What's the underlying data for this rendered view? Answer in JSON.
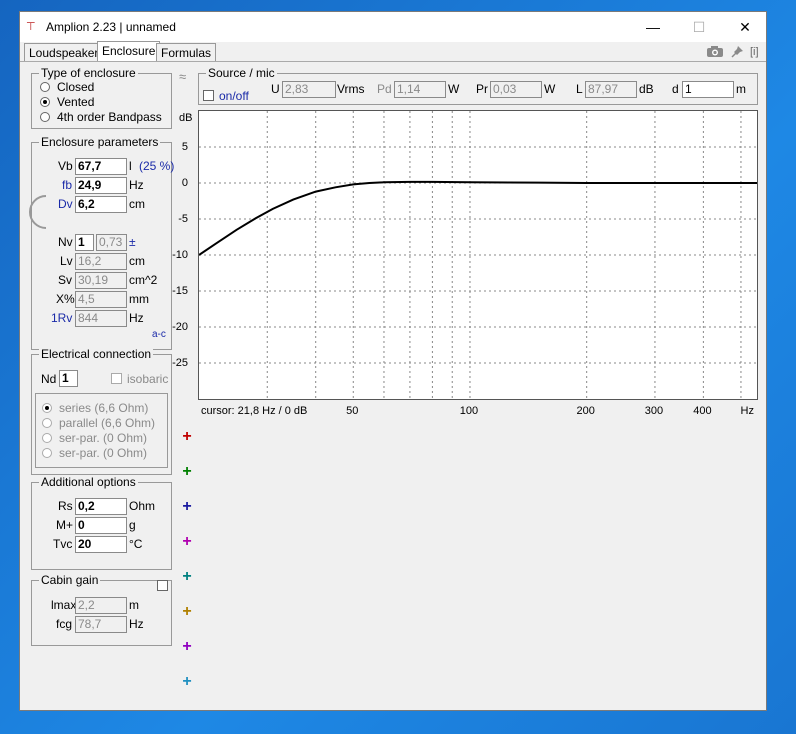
{
  "window": {
    "title": "Amplion 2.23 | unnamed",
    "min_glyph": "—",
    "max_glyph": "☐",
    "close_glyph": "✕"
  },
  "tabs": [
    {
      "label": "Loudspeaker",
      "active": false
    },
    {
      "label": "Enclosure",
      "active": true
    },
    {
      "label": "Formulas",
      "active": false
    }
  ],
  "toolbar_icons": [
    "camera-icon",
    "pin-icon",
    "info-icon"
  ],
  "info_glyph": "[i]",
  "enclosure_type": {
    "title": "Type of enclosure",
    "options": [
      {
        "label": "Closed",
        "selected": false
      },
      {
        "label": "Vented",
        "selected": true
      },
      {
        "label": "4th order Bandpass",
        "selected": false
      }
    ]
  },
  "enclosure_params": {
    "title": "Enclosure parameters",
    "vb": {
      "label": "Vb",
      "value": "67,7",
      "unit": "l",
      "extra": "(25 %)"
    },
    "fb": {
      "label": "fb",
      "value": "24,9",
      "unit": "Hz"
    },
    "dv": {
      "label": "Dv",
      "value": "6,2",
      "unit": "cm"
    },
    "nv": {
      "label": "Nv",
      "value": "1",
      "value2": "0,73",
      "unit": "±"
    },
    "lv": {
      "label": "Lv",
      "value": "16,2",
      "unit": "cm"
    },
    "sv": {
      "label": "Sv",
      "value": "30,19",
      "unit": "cm^2"
    },
    "xp": {
      "label": "X%",
      "value": "4,5",
      "unit": "mm"
    },
    "rv": {
      "label": "1Rv",
      "value": "844",
      "unit": "Hz"
    },
    "ac_link": "a-c"
  },
  "electrical": {
    "title": "Electrical connection",
    "nd_label": "Nd",
    "nd_value": "1",
    "isobaric_label": "isobaric",
    "options": [
      {
        "label": "series (6,6 Ohm)",
        "selected": true
      },
      {
        "label": "parallel (6,6 Ohm)",
        "selected": false
      },
      {
        "label": "ser-par. (0 Ohm)",
        "selected": false
      },
      {
        "label": "ser-par. (0 Ohm)",
        "selected": false
      }
    ]
  },
  "additional": {
    "title": "Additional options",
    "rs": {
      "label": "Rs",
      "value": "0,2",
      "unit": "Ohm"
    },
    "mplus": {
      "label": "M+",
      "value": "0",
      "unit": "g"
    },
    "tvc": {
      "label": "Tvc",
      "value": "20",
      "unit": "°C"
    }
  },
  "cabin": {
    "title": "Cabin gain",
    "lmax": {
      "label": "lmax",
      "value": "2,2",
      "unit": "m"
    },
    "fcg": {
      "label": "fcg",
      "value": "78,7",
      "unit": "Hz"
    }
  },
  "source": {
    "title": "Source / mic",
    "onoff_label": "on/off",
    "u": {
      "label": "U",
      "value": "2,83",
      "unit": "Vrms"
    },
    "pd": {
      "label": "Pd",
      "value": "1,14",
      "unit": "W"
    },
    "pr": {
      "label": "Pr",
      "value": "0,03",
      "unit": "W"
    },
    "l": {
      "label": "L",
      "value": "87,97",
      "unit": "dB"
    },
    "d": {
      "label": "d",
      "value": "1",
      "unit": "m"
    }
  },
  "collapse_glyph": "≈",
  "cursor_text": "cursor: 21,8 Hz / 0 dB",
  "plus_glyph": "+",
  "plus_colors": [
    "#c00000",
    "#008000",
    "#1a1aa0",
    "#b000b0",
    "#008080",
    "#b08000",
    "#9000c0",
    "#2090c0"
  ],
  "chart_data": {
    "type": "line",
    "ylabel": "dB",
    "xlabel": "Hz",
    "x_scale": "log",
    "xlim": [
      20,
      550
    ],
    "ylim": [
      -30,
      10
    ],
    "yticks": [
      5,
      0,
      -5,
      -10,
      -15,
      -20,
      -25
    ],
    "xticks_labeled": [
      50,
      100,
      200,
      300,
      400
    ],
    "grid": true,
    "series": [
      {
        "color": "#000000",
        "x": [
          20,
          22,
          25,
          28,
          31,
          35,
          40,
          45,
          50,
          55,
          60,
          70,
          80,
          100,
          150,
          200,
          300,
          550
        ],
        "y": [
          -10,
          -8.5,
          -6.5,
          -4.9,
          -3.6,
          -2.3,
          -1.2,
          -0.6,
          -0.2,
          0,
          0.1,
          0.15,
          0.15,
          0.1,
          0.05,
          0,
          0,
          0
        ]
      }
    ]
  }
}
